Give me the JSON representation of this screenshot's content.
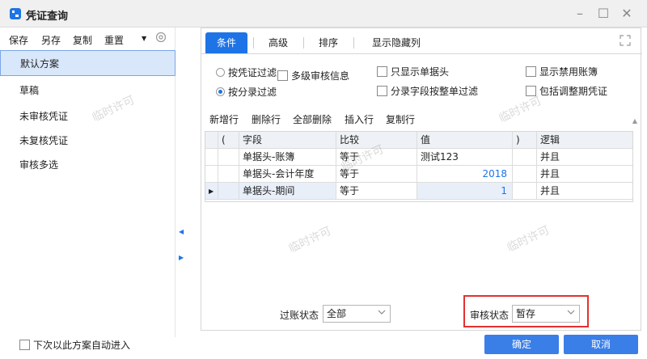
{
  "window": {
    "title": "凭证查询"
  },
  "toolbar": {
    "save": "保存",
    "save_as": "另存",
    "copy": "复制",
    "reset": "重置"
  },
  "schemes": [
    "默认方案",
    "草稿",
    "未审核凭证",
    "未复核凭证",
    "审核多选"
  ],
  "tabs": [
    "条件",
    "高级",
    "排序",
    "显示隐藏列"
  ],
  "filters": {
    "by_voucher": "按凭证过滤",
    "multi_audit": "多级审核信息",
    "by_entry": "按分录过滤",
    "only_header": "只显示单据头",
    "entry_field_filter": "分录字段按整单过滤",
    "show_disabled_books": "显示禁用账簿",
    "include_adjust": "包括调整期凭证"
  },
  "row_actions": [
    "新增行",
    "删除行",
    "全部删除",
    "插入行",
    "复制行"
  ],
  "grid": {
    "headers": [
      "(",
      "字段",
      "比较",
      "值",
      ")",
      "逻辑"
    ],
    "rows": [
      {
        "lp": "",
        "field": "单据头-账簿",
        "compare": "等于",
        "value": "测试123",
        "rp": "",
        "logic": "并且"
      },
      {
        "lp": "",
        "field": "单据头-会计年度",
        "compare": "等于",
        "value": "2018",
        "rp": "",
        "logic": "并且"
      },
      {
        "lp": "",
        "field": "单据头-期间",
        "compare": "等于",
        "value": "1",
        "rp": "",
        "logic": "并且"
      }
    ]
  },
  "posting_status": {
    "label": "过账状态",
    "value": "全部"
  },
  "audit_status": {
    "label": "审核状态",
    "value": "暂存"
  },
  "footer": {
    "auto_enter": "下次以此方案自动进入",
    "ok": "确定",
    "cancel": "取消"
  },
  "watermark": "临时许可",
  "colors": {
    "accent": "#1e74e6",
    "highlight_box": "#e53030"
  }
}
